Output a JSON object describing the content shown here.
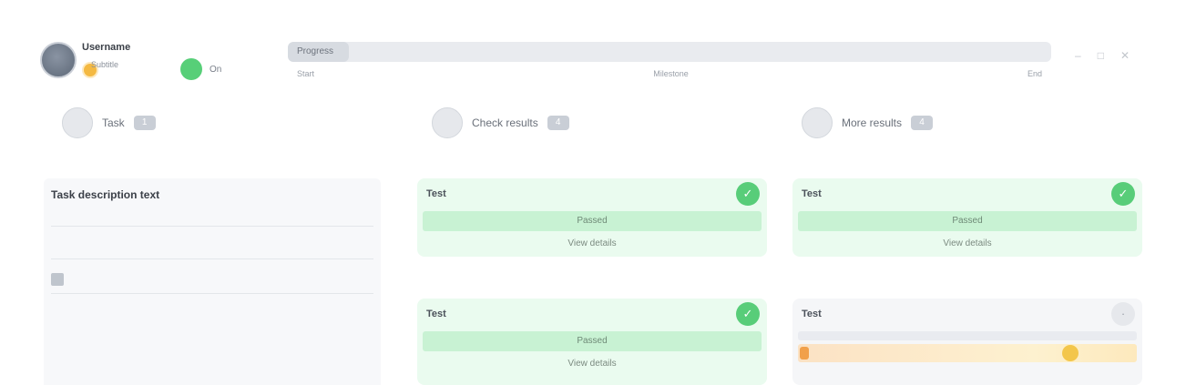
{
  "header": {
    "user_name": "Username",
    "user_sub": "Subtitle",
    "status_text": "On",
    "progress": {
      "fraction": 0.08,
      "label": "Progress",
      "ticks": [
        "Start",
        "Milestone",
        "End"
      ]
    },
    "window_controls": [
      "–",
      "□",
      "✕"
    ]
  },
  "columns": [
    {
      "icon": "",
      "title": "Task",
      "count": "1"
    },
    {
      "icon": "",
      "title": "Check results",
      "count": "4"
    },
    {
      "icon": "",
      "title": "More results",
      "count": "4"
    }
  ],
  "left_panel": {
    "task_title": "Task description text",
    "line1": "",
    "line2": ""
  },
  "cards": [
    {
      "name": "Test",
      "status": "pass",
      "band": "Passed",
      "sub": "View details"
    },
    {
      "name": "Test",
      "status": "pass",
      "band": "Passed",
      "sub": "View details"
    },
    {
      "name": "Test",
      "status": "pass",
      "band": "Passed",
      "sub": "View details"
    },
    {
      "name": "Test",
      "status": "warning",
      "band": "",
      "sub": ""
    }
  ],
  "colors": {
    "pass": "#58cd79",
    "pass_band": "#c8f2d3",
    "warn": "#f3c64b",
    "accent_orange": "#f4b942"
  },
  "icons": {
    "pass_badge": "check-icon",
    "close": "close-icon"
  }
}
